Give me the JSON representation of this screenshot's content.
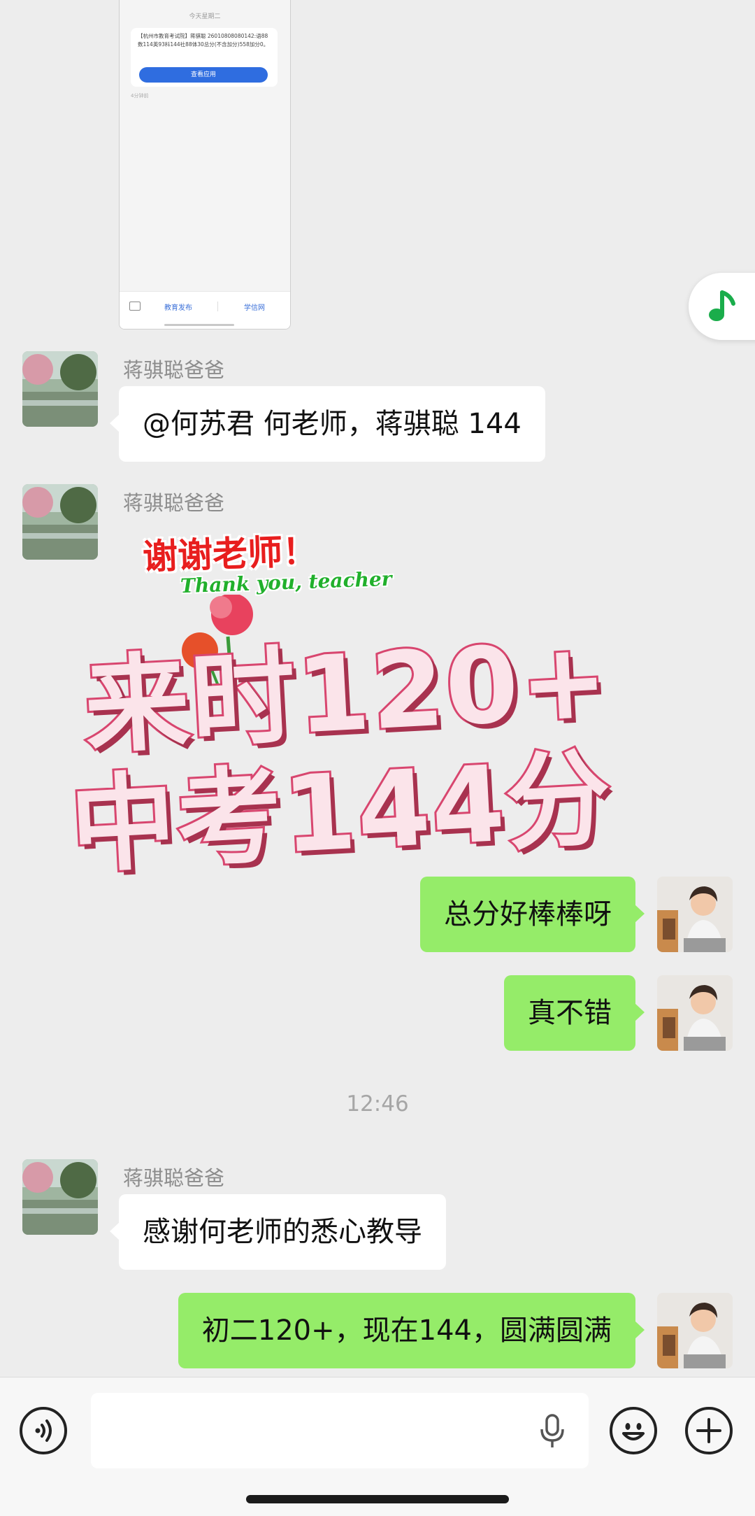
{
  "embedded_screenshot": {
    "header_text": "今天星期二",
    "sms_text": "【杭州市教育考试院】蒋骐聪 2601080808014​2:语88数114英93科144社88体30总分(不含加分)558加分0。",
    "button_label": "查看应用",
    "meta_text": "4分钟前",
    "bottom_tabs": [
      "教育发布",
      "学信网"
    ]
  },
  "music_button": {
    "icon": "music-note-icon",
    "color": "#1aad4b"
  },
  "messages": [
    {
      "side": "left",
      "sender": "蒋骐聪爸爸",
      "text": "@何苏君  何老师，蒋骐聪 144"
    },
    {
      "side": "left",
      "sender": "蒋骐聪爸爸",
      "type": "sticker",
      "sticker": {
        "thanks_cn": "谢谢老师！",
        "thanks_en": "Thank you, teacher",
        "line1": "来时120+",
        "line2": "中考144分"
      }
    },
    {
      "side": "right",
      "text": "总分好棒棒呀"
    },
    {
      "side": "right",
      "text": "真不错"
    },
    {
      "type": "time",
      "text": "12:46"
    },
    {
      "side": "left",
      "sender": "蒋骐聪爸爸",
      "text": "感谢何老师的悉心教导"
    },
    {
      "side": "right",
      "text": "初二120+，现在144，圆满圆满"
    }
  ],
  "input_bar": {
    "voice_icon": "voice-icon",
    "mic_icon": "microphone-icon",
    "emoji_icon": "emoji-icon",
    "plus_icon": "plus-icon"
  },
  "colors": {
    "background": "#ededed",
    "outgoing_bubble": "#95ec69",
    "incoming_bubble": "#ffffff"
  }
}
